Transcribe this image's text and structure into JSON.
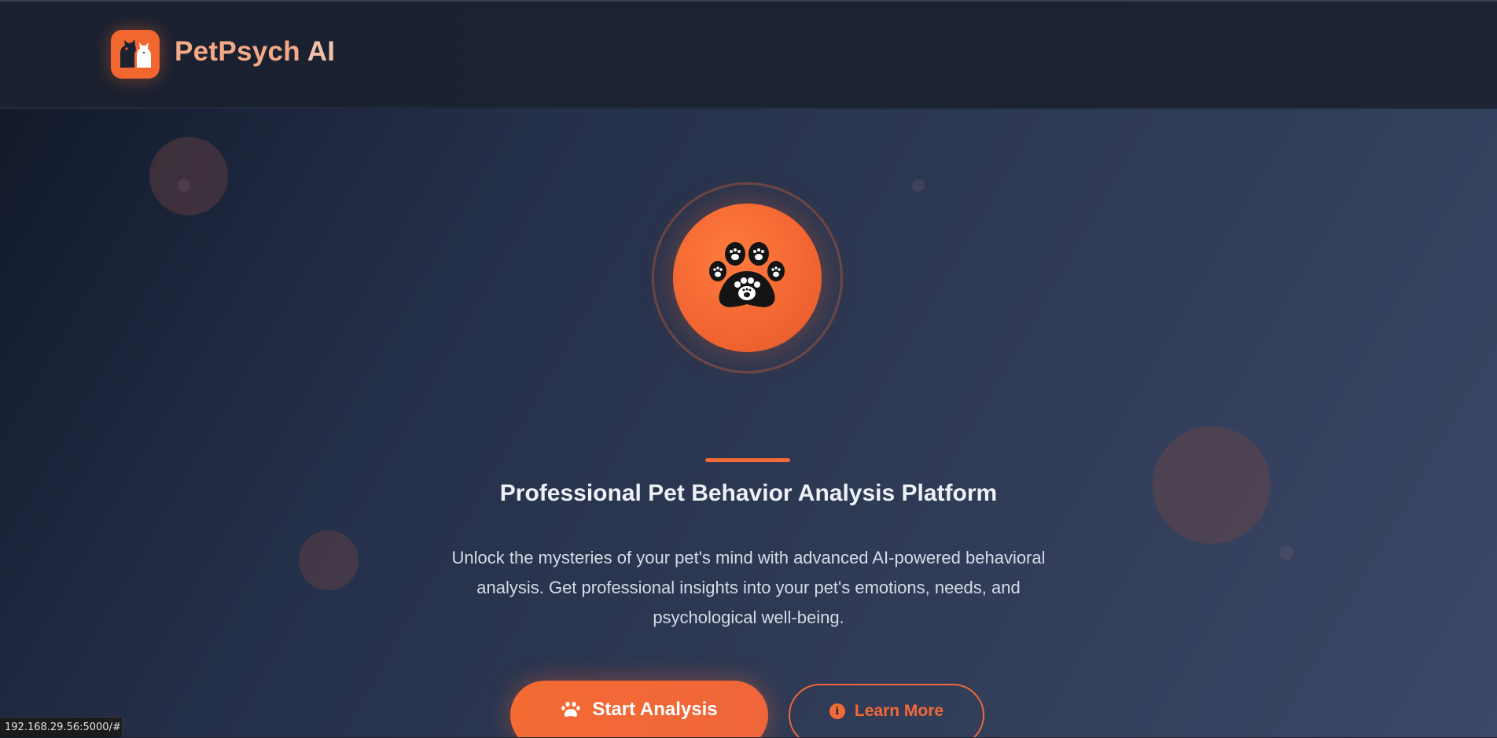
{
  "header": {
    "brand_name": "PetPsych AI",
    "brand_main": "PetPsych ",
    "brand_suffix": "AI",
    "logo_icon": "pets-logo-icon"
  },
  "hero": {
    "icon": "paw-print-icon",
    "subtitle": "Professional Pet Behavior Analysis Platform",
    "description": "Unlock the mysteries of your pet's mind with advanced AI-powered behavioral analysis. Get professional insights into your pet's emotions, needs, and psychological well-being.",
    "primary_button": {
      "label": "Start Analysis",
      "icon": "paw-icon"
    },
    "secondary_button": {
      "label": "Learn More",
      "icon": "info-circle-icon"
    }
  },
  "status_bar": {
    "url": "192.168.29.56:5000/#"
  },
  "colors": {
    "accent": "#f26a35",
    "header_bg": "#1b2232",
    "hero_bg_start": "#121a2b",
    "hero_bg_end": "#3b4866",
    "text": "#eef1f7"
  }
}
